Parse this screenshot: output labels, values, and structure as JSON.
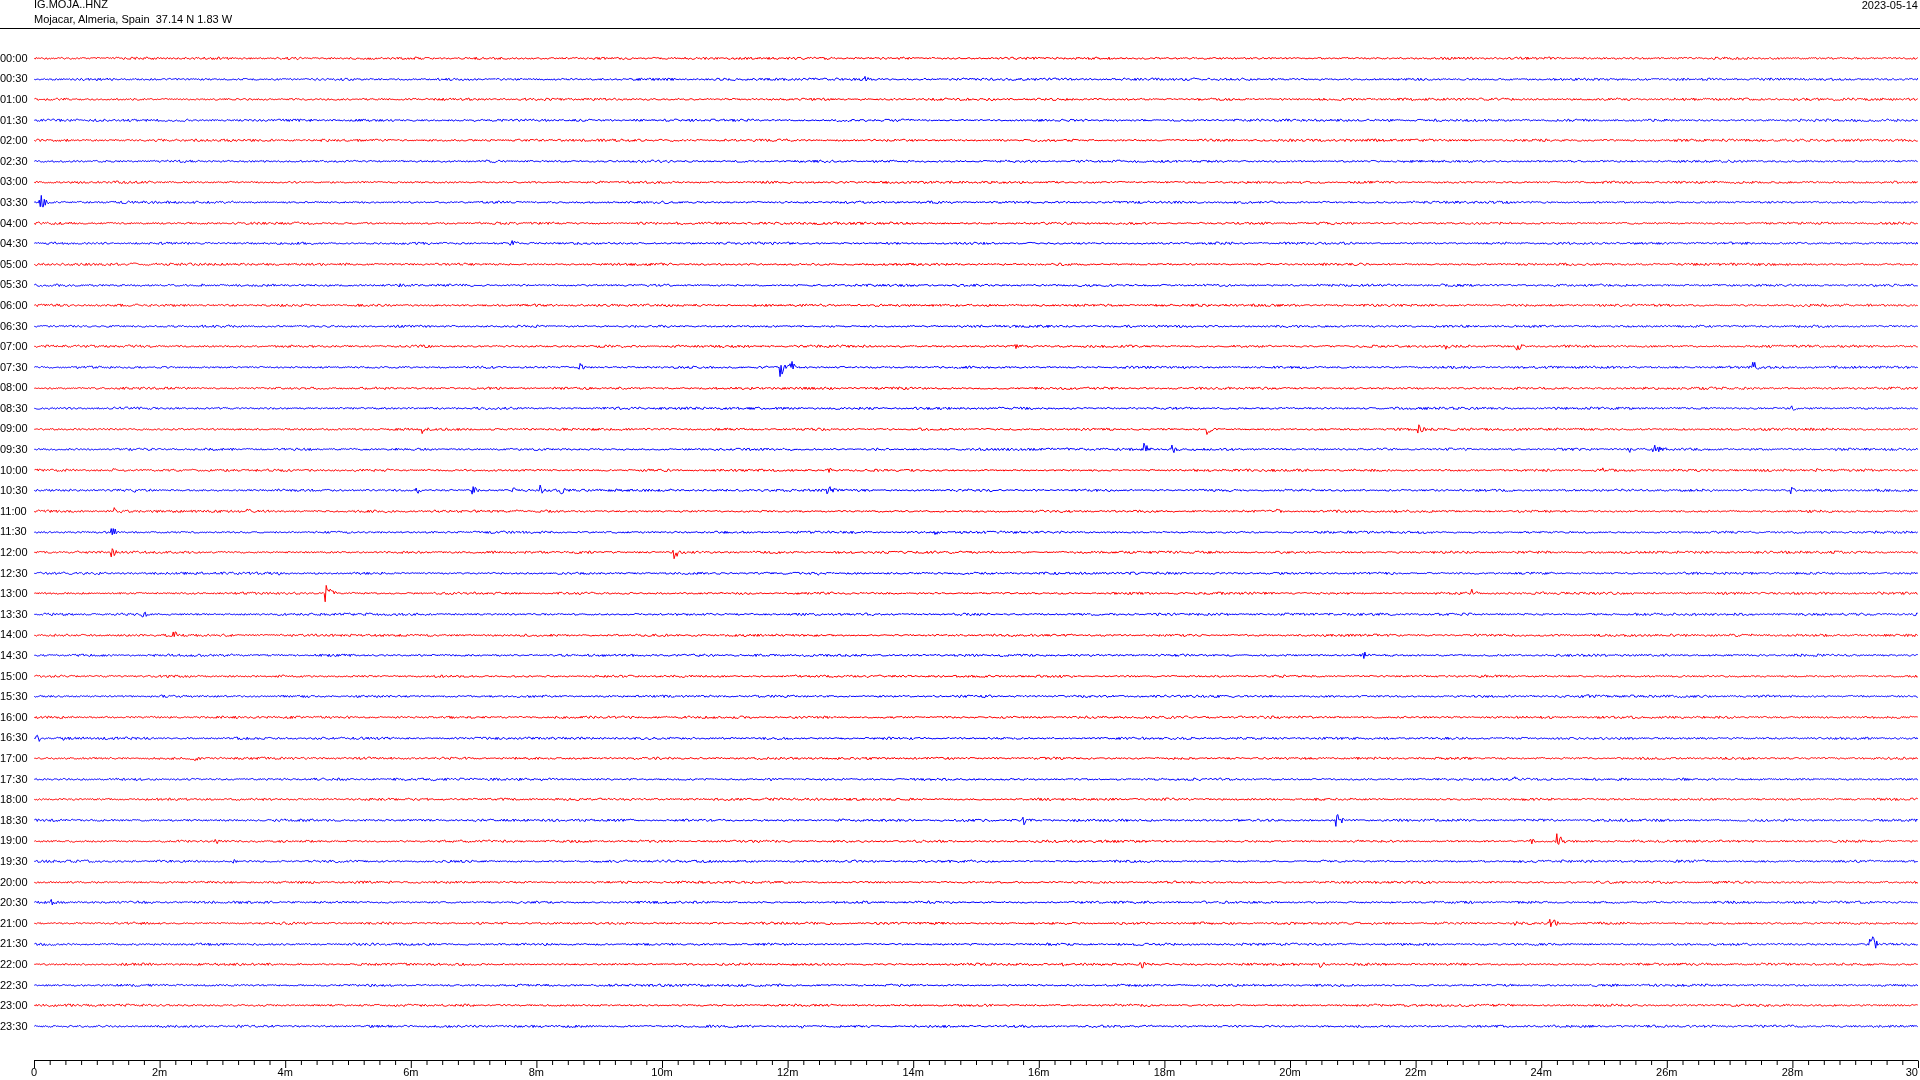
{
  "header": {
    "title": "IG.MOJA..HNZ",
    "location": "Mojacar, Almeria, Spain  37.14 N 1.83 W",
    "date": "2023-05-14"
  },
  "traces": [
    {
      "label": "00:00",
      "color": "#ff0000"
    },
    {
      "label": "00:30",
      "color": "#0000ff"
    },
    {
      "label": "01:00",
      "color": "#ff0000"
    },
    {
      "label": "01:30",
      "color": "#0000ff"
    },
    {
      "label": "02:00",
      "color": "#ff0000"
    },
    {
      "label": "02:30",
      "color": "#0000ff"
    },
    {
      "label": "03:00",
      "color": "#ff0000"
    },
    {
      "label": "03:30",
      "color": "#0000ff"
    },
    {
      "label": "04:00",
      "color": "#ff0000"
    },
    {
      "label": "04:30",
      "color": "#0000ff"
    },
    {
      "label": "05:00",
      "color": "#ff0000"
    },
    {
      "label": "05:30",
      "color": "#0000ff"
    },
    {
      "label": "06:00",
      "color": "#ff0000"
    },
    {
      "label": "06:30",
      "color": "#0000ff"
    },
    {
      "label": "07:00",
      "color": "#ff0000"
    },
    {
      "label": "07:30",
      "color": "#0000ff"
    },
    {
      "label": "08:00",
      "color": "#ff0000"
    },
    {
      "label": "08:30",
      "color": "#0000ff"
    },
    {
      "label": "09:00",
      "color": "#ff0000"
    },
    {
      "label": "09:30",
      "color": "#0000ff"
    },
    {
      "label": "10:00",
      "color": "#ff0000"
    },
    {
      "label": "10:30",
      "color": "#0000ff"
    },
    {
      "label": "11:00",
      "color": "#ff0000"
    },
    {
      "label": "11:30",
      "color": "#0000ff"
    },
    {
      "label": "12:00",
      "color": "#ff0000"
    },
    {
      "label": "12:30",
      "color": "#0000ff"
    },
    {
      "label": "13:00",
      "color": "#ff0000"
    },
    {
      "label": "13:30",
      "color": "#0000ff"
    },
    {
      "label": "14:00",
      "color": "#ff0000"
    },
    {
      "label": "14:30",
      "color": "#0000ff"
    },
    {
      "label": "15:00",
      "color": "#ff0000"
    },
    {
      "label": "15:30",
      "color": "#0000ff"
    },
    {
      "label": "16:00",
      "color": "#ff0000"
    },
    {
      "label": "16:30",
      "color": "#0000ff"
    },
    {
      "label": "17:00",
      "color": "#ff0000"
    },
    {
      "label": "17:30",
      "color": "#0000ff"
    },
    {
      "label": "18:00",
      "color": "#ff0000"
    },
    {
      "label": "18:30",
      "color": "#0000ff"
    },
    {
      "label": "19:00",
      "color": "#ff0000"
    },
    {
      "label": "19:30",
      "color": "#0000ff"
    },
    {
      "label": "20:00",
      "color": "#ff0000"
    },
    {
      "label": "20:30",
      "color": "#0000ff"
    },
    {
      "label": "21:00",
      "color": "#ff0000"
    },
    {
      "label": "21:30",
      "color": "#0000ff"
    },
    {
      "label": "22:00",
      "color": "#ff0000"
    },
    {
      "label": "22:30",
      "color": "#0000ff"
    },
    {
      "label": "23:00",
      "color": "#ff0000"
    },
    {
      "label": "23:30",
      "color": "#0000ff"
    }
  ],
  "x_axis": {
    "ticks": [
      "0",
      "2m",
      "4m",
      "6m",
      "8m",
      "10m",
      "12m",
      "14m",
      "16m",
      "18m",
      "20m",
      "22m",
      "24m",
      "26m",
      "28m",
      "30"
    ]
  }
}
